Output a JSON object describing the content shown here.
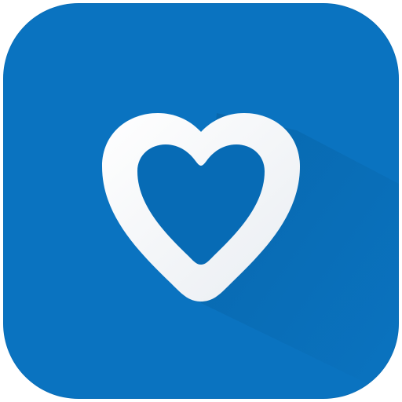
{
  "app_icon": {
    "icon_name": "heart-icon",
    "colors": {
      "background": "#0a73c0",
      "heart_fill": "#076bb5",
      "heart_outline": "#ffffff",
      "long_shadow": "#065f9f"
    }
  }
}
